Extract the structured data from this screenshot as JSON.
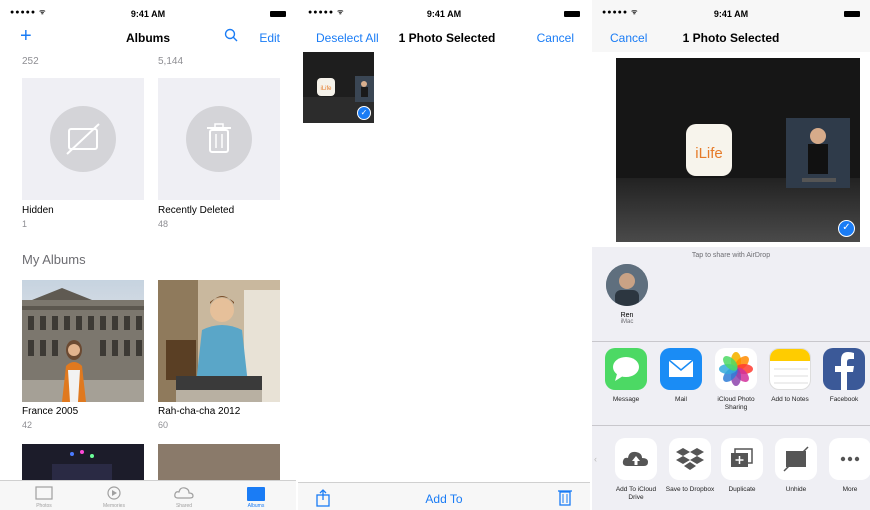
{
  "status": {
    "signal": "●●●●● ᯤ",
    "time": "9:41 AM"
  },
  "albums_screen": {
    "title": "Albums",
    "add_label": "+",
    "edit_label": "Edit",
    "top_counts": [
      "252",
      "5,144"
    ],
    "system_albums": [
      {
        "name": "Hidden",
        "count": "1",
        "icon": "hidden-icon"
      },
      {
        "name": "Recently Deleted",
        "count": "48",
        "icon": "trash-icon"
      }
    ],
    "section_title": "My Albums",
    "my_albums": [
      {
        "name": "France 2005",
        "count": "42"
      },
      {
        "name": "Rah-cha-cha 2012",
        "count": "60"
      }
    ],
    "tabs": [
      "Photos",
      "Memories",
      "Shared",
      "Albums"
    ]
  },
  "select_screen": {
    "deselect_label": "Deselect All",
    "title": "1 Photo Selected",
    "cancel_label": "Cancel",
    "add_to_label": "Add To",
    "thumb_text": "iLife"
  },
  "share_screen": {
    "cancel_label": "Cancel",
    "title": "1 Photo Selected",
    "preview_text": "iLife",
    "airdrop_hint": "Tap to share with AirDrop",
    "airdrop_person": {
      "name": "Ren",
      "device": "iMac"
    },
    "apps": [
      {
        "label": "Message",
        "icon": "message-icon",
        "color": "#4cd964"
      },
      {
        "label": "Mail",
        "icon": "mail-icon",
        "color": "#1a8cf5"
      },
      {
        "label": "iCloud Photo Sharing",
        "icon": "photos-icon",
        "color": "#ffffff"
      },
      {
        "label": "Add to Notes",
        "icon": "notes-icon",
        "color": "#ffffff"
      },
      {
        "label": "Facebook",
        "icon": "facebook-icon",
        "color": "#3b5998"
      }
    ],
    "actions": [
      {
        "label": "Add To iCloud Drive",
        "icon": "icloud-upload-icon"
      },
      {
        "label": "Save to Dropbox",
        "icon": "dropbox-icon"
      },
      {
        "label": "Duplicate",
        "icon": "duplicate-icon"
      },
      {
        "label": "Unhide",
        "icon": "unhide-icon"
      },
      {
        "label": "More",
        "icon": "more-icon"
      }
    ]
  },
  "colors": {
    "accent": "#1a7cf5",
    "grouped_bg": "#efeff4"
  }
}
